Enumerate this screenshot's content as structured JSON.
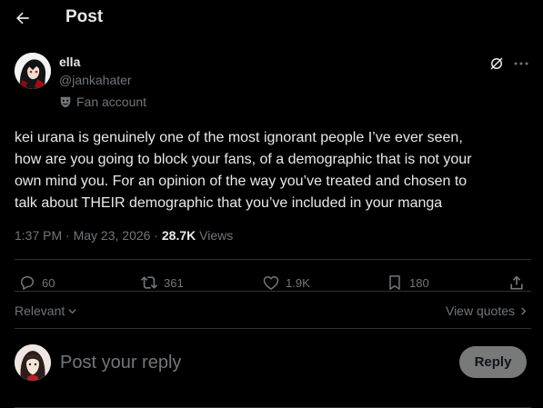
{
  "header": {
    "title": "Post"
  },
  "author": {
    "display_name": "ella",
    "handle": "@jankahater",
    "affiliation_label": "Fan account"
  },
  "tweet": {
    "lines": [
      "kei urana is genuinely one of the most ignorant people I’ve ever seen,",
      "how are you going to block your fans, of a demographic that is not your",
      "own mind you. For an opinion of the way you’ve treated and chosen to",
      "talk about THEIR demographic that you’ve included in your manga"
    ],
    "time": "1:37 PM",
    "date": "May 23, 2026",
    "views_count": "28.7K",
    "views_label": "Views"
  },
  "actions": {
    "replies": "60",
    "reposts": "361",
    "likes": "1.9K",
    "bookmarks": "180"
  },
  "sort": {
    "label": "Relevant",
    "view_quotes": "View quotes"
  },
  "reply": {
    "placeholder": "Post your reply",
    "button_label": "Reply"
  },
  "colors": {
    "background": "#000000",
    "text_primary": "#e7e9ea",
    "text_secondary": "#71767b",
    "divider": "#2f3336",
    "reply_button": "#787a7a"
  },
  "icons": [
    "back-arrow-icon",
    "grok-icon",
    "more-icon",
    "mask-icon",
    "reply-icon",
    "repost-icon",
    "like-icon",
    "bookmark-icon",
    "share-icon",
    "chevron-down-icon",
    "chevron-right-icon"
  ]
}
